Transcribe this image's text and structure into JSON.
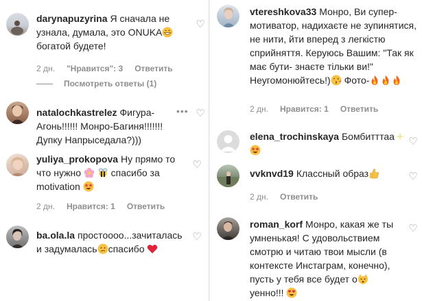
{
  "left": {
    "comments": [
      {
        "username": "darynapuzyrina",
        "text": "Я сначала не узнала, думала, это ONUKA",
        "text2": " богатой будете!",
        "meta": {
          "time": "2 дн.",
          "likes": "\"Нравится\": 3",
          "reply": "Ответить"
        },
        "view_replies": "Посмотреть ответы (1)"
      },
      {
        "username": "natalochkastrelez",
        "text": "Фигура-Агонь!!!!!! Монро-Багиня!!!!!!! Дупку Напрыседала?)))"
      },
      {
        "username": "yuliya_prokopova",
        "text": "Ну прямо то что нужно ",
        "text2": " спасибо за motivation ",
        "meta": {
          "time": "2 дн.",
          "likes": "Нравится: 1",
          "reply": "Ответить"
        }
      },
      {
        "username": "ba.ola.la",
        "text": "простоооо...зачиталась и задумалась",
        "text2": "спасибо "
      }
    ]
  },
  "right": {
    "comments": [
      {
        "username": "vtereshkova33",
        "text": "Монро, Ви супер-мотиватор, надихаєте не зупинятися, не нити, йти вперед з легкістю сприйняття. Керуюсь Вашим: \"Так як має бути- знаєте тільки ви!\" Неугомонюйтесь!)",
        "text2": " Фото-",
        "meta": {
          "time": "2 дн.",
          "likes": "Нравится: 1",
          "reply": "Ответить"
        }
      },
      {
        "username": "elena_trochinskaya",
        "text": "Бомбитттаа"
      },
      {
        "username": "vvknvd19",
        "text": "Классный образ",
        "meta": {
          "time": "2 дн.",
          "reply": "Ответить"
        }
      },
      {
        "username": "roman_korf",
        "text": "Монро, какая же ты умненькая! С удовольствием смотрю и читаю твои мысли (в контексте Инстаграм, конечно), пусть у тебя все будет о",
        "text2": "уенно!!! "
      }
    ]
  },
  "colors": {
    "text": "#262626",
    "secondary": "#8e8e8e",
    "divider": "#efefef",
    "heart_red": "#ed4956"
  },
  "icons": {
    "like": "heart-outline-icon",
    "more": "ellipsis-icon"
  }
}
